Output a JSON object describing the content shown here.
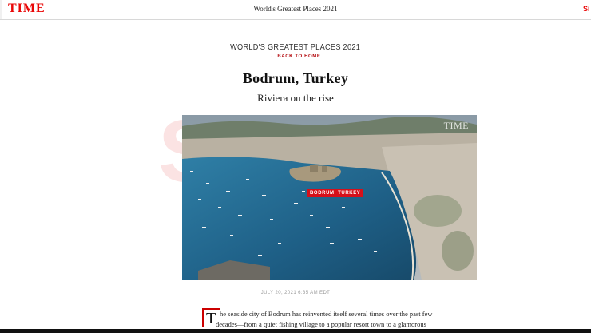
{
  "header": {
    "logo": "TIME",
    "title": "World's Greatest Places 2021",
    "signin": "Si"
  },
  "article": {
    "kicker": "WORLD'S GREATEST PLACES 2021",
    "back_link": "← BACK TO HOME",
    "headline": "Bodrum, Turkey",
    "subhead": "Riviera on the rise",
    "photo": {
      "watermark": "TIME",
      "location_tag": "BODRUM, TURKEY"
    },
    "date": "JULY 20, 2021 6:35 AM EDT",
    "dropcap": "T",
    "body_lines": [
      "he seaside city of Bodrum has reinvented itself several times over the past few",
      "decades—from a quiet fishing village to a popular resort town to a glamorous"
    ]
  },
  "colors": {
    "brand_red": "#e90606",
    "tag_red": "#d6101a",
    "sea": "#1e5f86"
  }
}
